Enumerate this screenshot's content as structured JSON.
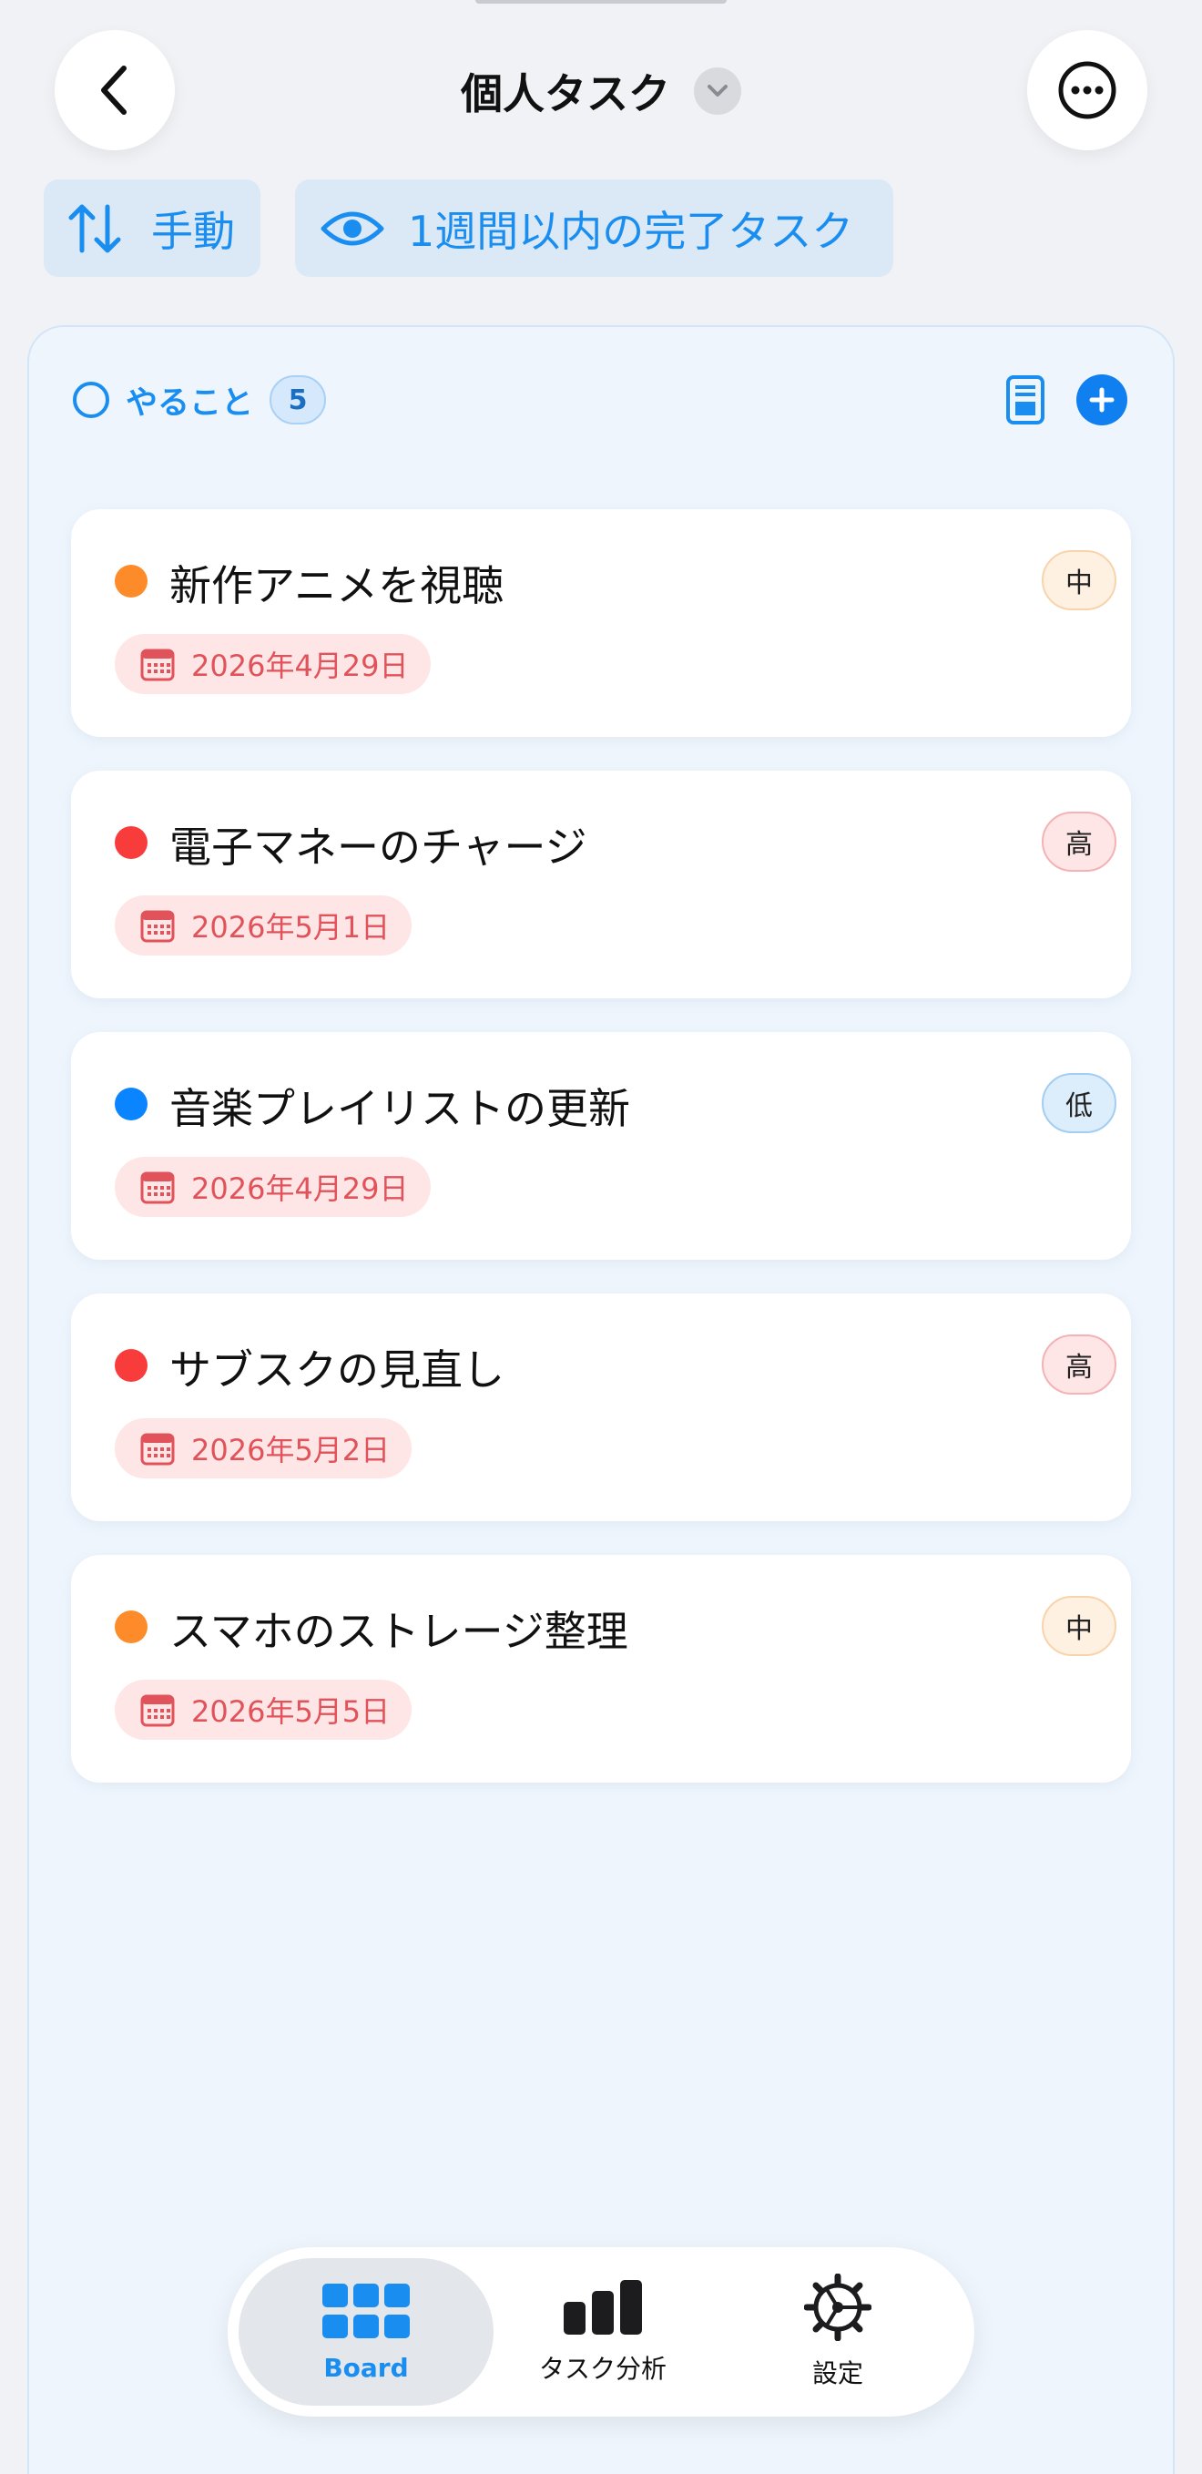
{
  "header": {
    "title": "個人タスク",
    "back_icon": "chevron-left-icon",
    "more_icon": "ellipsis-circle-icon"
  },
  "filters": {
    "sort_label": "手動",
    "visibility_label": "1週間以内の完了タスク"
  },
  "column": {
    "title": "やること",
    "count": "5"
  },
  "tasks": [
    {
      "title": "新作アニメを視聴",
      "date": "2026年4月29日",
      "priority": "中",
      "priority_level": "mid",
      "dot_color": "#fd8b2a"
    },
    {
      "title": "電子マネーのチャージ",
      "date": "2026年5月1日",
      "priority": "高",
      "priority_level": "high",
      "dot_color": "#f83c3c"
    },
    {
      "title": "音楽プレイリストの更新",
      "date": "2026年4月29日",
      "priority": "低",
      "priority_level": "low",
      "dot_color": "#0a84ff"
    },
    {
      "title": "サブスクの見直し",
      "date": "2026年5月2日",
      "priority": "高",
      "priority_level": "high",
      "dot_color": "#f83c3c"
    },
    {
      "title": "スマホのストレージ整理",
      "date": "2026年5月5日",
      "priority": "中",
      "priority_level": "mid",
      "dot_color": "#fd8b2a"
    }
  ],
  "tabbar": {
    "board_label": "Board",
    "analytics_label": "タスク分析",
    "settings_label": "設定"
  },
  "colors": {
    "accent": "#1a8ef0",
    "date_text": "#e0535a",
    "high": "#f83c3c",
    "mid": "#fd8b2a",
    "low": "#0a84ff"
  }
}
